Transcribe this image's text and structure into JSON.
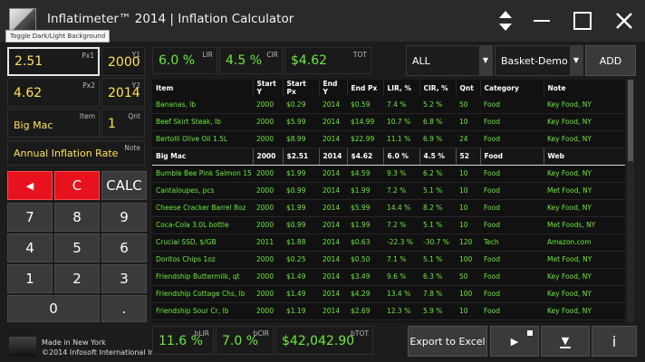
{
  "app": {
    "title": "Inflatimeter™ 2014 | Inflation Calculator",
    "tooltip": "Toggle Dark/Light Background"
  },
  "inputs": {
    "px1": {
      "label": "Px1",
      "value": "2.51"
    },
    "y1": {
      "label": "Y1",
      "value": "2000"
    },
    "px2": {
      "label": "Px2",
      "value": "4.62"
    },
    "y2": {
      "label": "Y2",
      "value": "2014"
    },
    "item": {
      "label": "Item",
      "value": "Big Mac"
    },
    "qnt": {
      "label": "Qnt",
      "value": "1"
    },
    "note": {
      "label": "Note",
      "value": "Annual Inflation Rate"
    }
  },
  "results": {
    "lir": {
      "label": "LIR",
      "value": "6.0 %"
    },
    "cir": {
      "label": "CIR",
      "value": "4.5 %"
    },
    "tot": {
      "label": "TOT",
      "value": "$4.62"
    }
  },
  "keypad": {
    "back": "◀",
    "clear": "C",
    "calc": "CALC",
    "digits": [
      "7",
      "8",
      "9",
      "4",
      "5",
      "6",
      "1",
      "2",
      "3"
    ],
    "zero": "0",
    "dot": "."
  },
  "filters": {
    "category": "ALL",
    "basket": "Basket-Demo",
    "add": "ADD"
  },
  "table": {
    "headers": [
      "Item",
      "Start Y",
      "Start Px",
      "End Y",
      "End Px",
      "LIR, %",
      "CIR, %",
      "Qnt",
      "Category",
      "Note"
    ],
    "rows": [
      [
        "Bananas, lb",
        "2000",
        "$0.29",
        "2014",
        "$0.59",
        "7.4 %",
        "5.2 %",
        "50",
        "Food",
        "Key Food, NY"
      ],
      [
        "Beef Skirt Steak, lb",
        "2000",
        "$5.99",
        "2014",
        "$14.99",
        "10.7 %",
        "6.8 %",
        "10",
        "Food",
        "Key Food, NY"
      ],
      [
        "Bertolli Olive Oil 1.5L",
        "2000",
        "$8.99",
        "2014",
        "$22.99",
        "11.1 %",
        "6.9 %",
        "24",
        "Food",
        "Key Food, NY"
      ],
      [
        "Big Mac",
        "2000",
        "$2.51",
        "2014",
        "$4.62",
        "6.0 %",
        "4.5 %",
        "52",
        "Food",
        "Web"
      ],
      [
        "Bumble Bee Pink Salmon 15",
        "2000",
        "$1.99",
        "2014",
        "$4.59",
        "9.3 %",
        "6.2 %",
        "10",
        "Food",
        "Key Food, NY"
      ],
      [
        "Cantaloupes, pcs",
        "2000",
        "$0.99",
        "2014",
        "$1.99",
        "7.2 %",
        "5.1 %",
        "10",
        "Food",
        "Met Food, NY"
      ],
      [
        "Cheese Cracker Barrel 8oz",
        "2000",
        "$1.99",
        "2014",
        "$5.99",
        "14.4 %",
        "8.2 %",
        "10",
        "Food",
        "Key Food, NY"
      ],
      [
        "Coca-Cola 3.0L bottle",
        "2000",
        "$0.99",
        "2014",
        "$1.99",
        "7.2 %",
        "5.1 %",
        "10",
        "Food",
        "Met Foods, NY"
      ],
      [
        "Crucial SSD, $/GB",
        "2011",
        "$1.88",
        "2014",
        "$0.63",
        "-22.3 %",
        "-30.7 %",
        "120",
        "Tech",
        "Amazon.com"
      ],
      [
        "Doritos Chips 1oz",
        "2000",
        "$0.25",
        "2014",
        "$0.50",
        "7.1 %",
        "5.1 %",
        "100",
        "Food",
        "Met Food, NY"
      ],
      [
        "Friendship Buttermilk, qt",
        "2000",
        "$1.49",
        "2014",
        "$3.49",
        "9.6 %",
        "6.3 %",
        "50",
        "Food",
        "Key Food, NY"
      ],
      [
        "Friendship Cottage Chs, lb",
        "2000",
        "$1.49",
        "2014",
        "$4.29",
        "13.4 %",
        "7.8 %",
        "100",
        "Food",
        "Key Food, NY"
      ],
      [
        "Friendship Sour Cr, lb",
        "2000",
        "$1.19",
        "2014",
        "$2.69",
        "12.3 %",
        "5.9 %",
        "10",
        "Food",
        "Key Food, NY"
      ]
    ],
    "selected_index": 3
  },
  "totals": {
    "blir": {
      "label": "bLIR",
      "value": "11.6 %"
    },
    "bcir": {
      "label": "bCIR",
      "value": "7.0 %"
    },
    "btot": {
      "label": "bTOT",
      "value": "$42,042.90"
    }
  },
  "actions": {
    "export": "Export to Excel",
    "play": "▶",
    "down": "▼",
    "info": "i"
  },
  "footer": {
    "line1": "Made in New York",
    "line2": "©2014 Infosoft International Inc"
  },
  "colors": {
    "accent_red": "#e8111e",
    "value_yellow": "#ffe15a",
    "value_green": "#6bea3a"
  }
}
